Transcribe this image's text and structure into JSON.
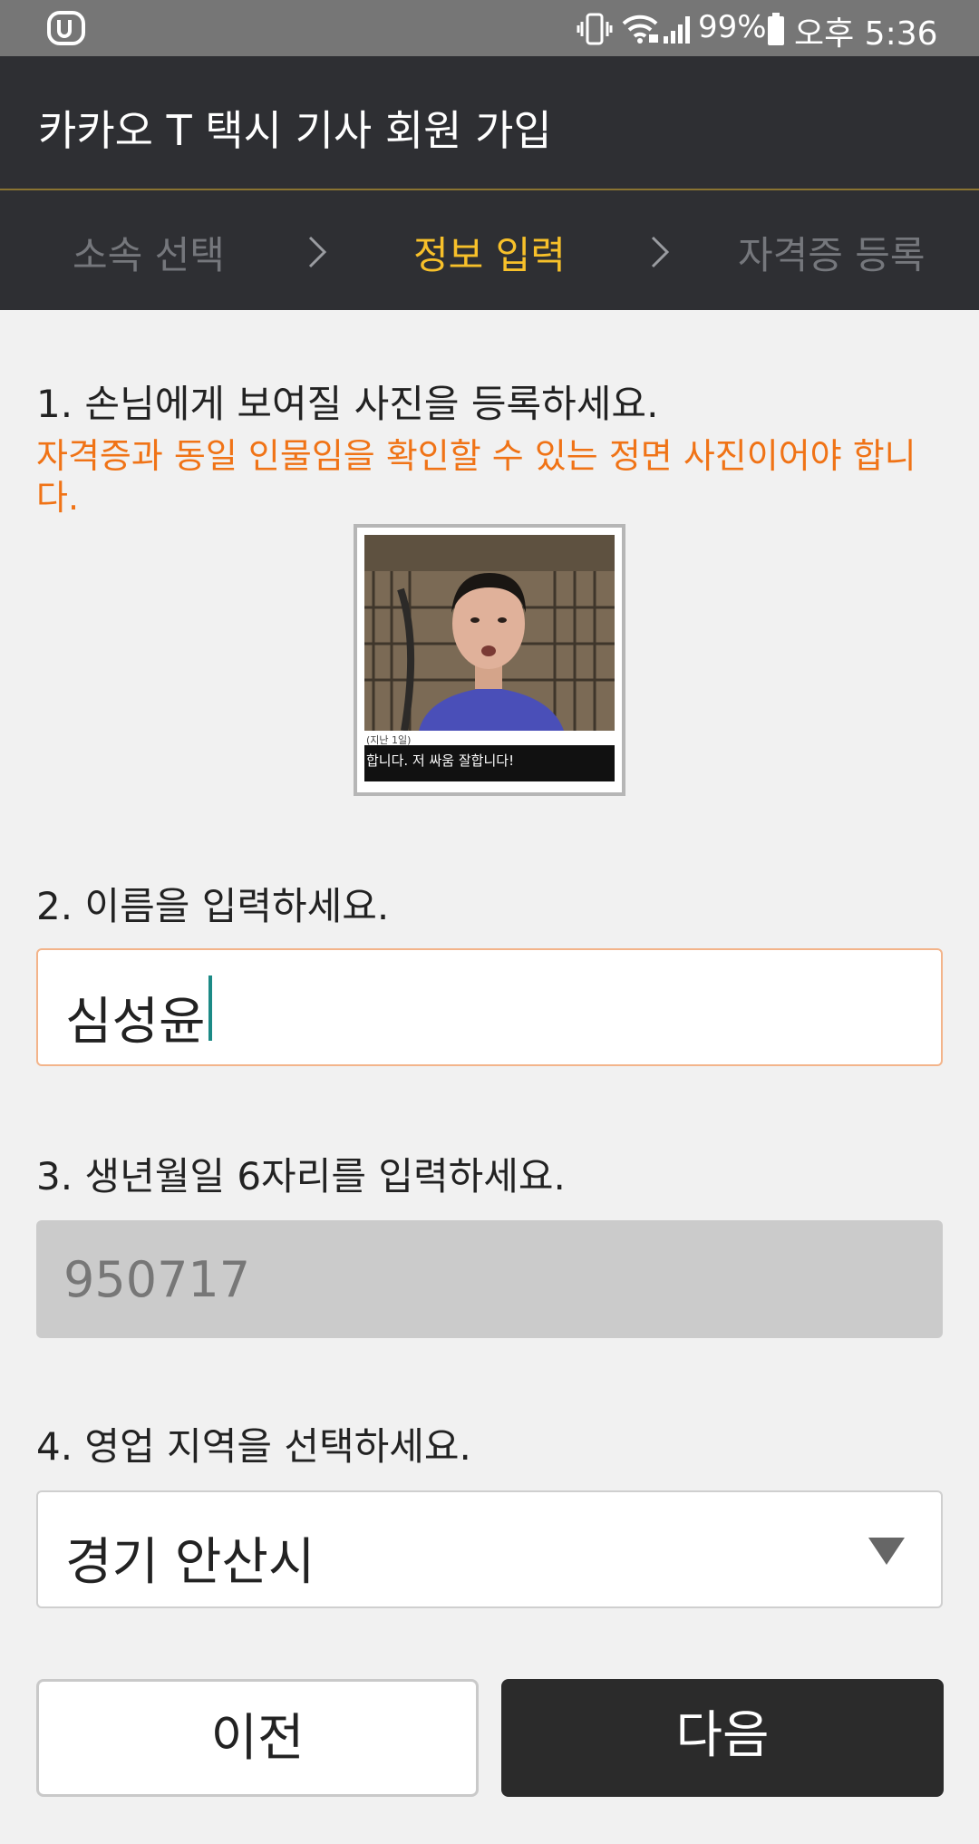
{
  "status_bar": {
    "battery": "99%",
    "time": "오후 5:36"
  },
  "app_bar": {
    "title": "카카오 T 택시 기사 회원 가입"
  },
  "steps": [
    {
      "label": "소속 선택",
      "state": "inactive"
    },
    {
      "label": "정보 입력",
      "state": "active"
    },
    {
      "label": "자격증 등록",
      "state": "inactive"
    }
  ],
  "colors": {
    "accent": "#f7c02a",
    "warning": "#f07316",
    "header_bg": "#2e2f33"
  },
  "form": {
    "photo": {
      "label": "1. 손님에게 보여질 사진을 등록하세요.",
      "warning": "자격증과 동일 인물임을 확인할 수 있는 정면 사진이어야 합니다.",
      "small_caption": "(지난 1일)",
      "caption": "합니다. 저 싸움 잘합니다!"
    },
    "name": {
      "label": "2. 이름을 입력하세요.",
      "value": "심성윤"
    },
    "birth": {
      "label": "3. 생년월일 6자리를 입력하세요.",
      "value": "950717"
    },
    "region": {
      "label": "4. 영업 지역을 선택하세요.",
      "value": "경기 안산시"
    }
  },
  "buttons": {
    "prev": "이전",
    "next": "다음"
  }
}
